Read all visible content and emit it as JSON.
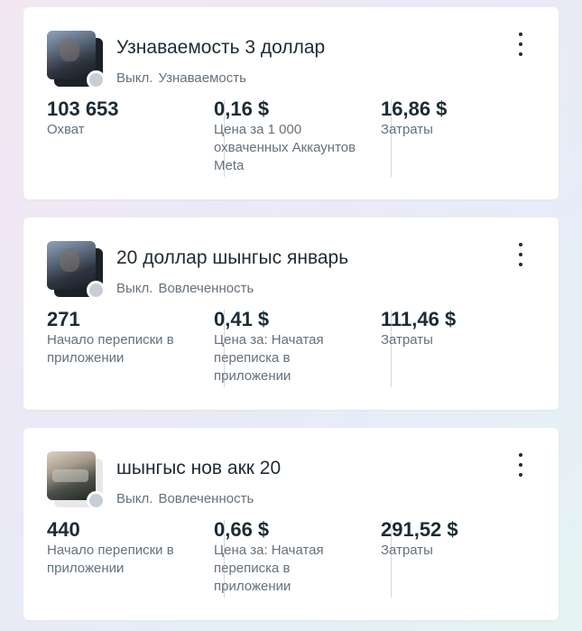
{
  "campaigns": [
    {
      "title": "Узнаваемость 3 доллар",
      "status": "Выкл.",
      "objective": "Узнаваемость",
      "metrics": [
        {
          "value": "103 653",
          "label": "Охват"
        },
        {
          "value": "0,16 $",
          "label": "Цена за 1 000 охваченных Аккаунтов Meta"
        },
        {
          "value": "16,86 $",
          "label": "Затраты"
        }
      ]
    },
    {
      "title": "20 доллар шынгыс январь",
      "status": "Выкл.",
      "objective": "Вовлеченность",
      "metrics": [
        {
          "value": "271",
          "label": "Начало переписки в приложении"
        },
        {
          "value": "0,41 $",
          "label": "Цена за: Начатая переписка в приложении"
        },
        {
          "value": "111,46 $",
          "label": "Затраты"
        }
      ]
    },
    {
      "title": "шынгыс нов акк 20",
      "status": "Выкл.",
      "objective": "Вовлеченность",
      "metrics": [
        {
          "value": "440",
          "label": "Начало переписки в приложении"
        },
        {
          "value": "0,66 $",
          "label": "Цена за: Начатая переписка в приложении"
        },
        {
          "value": "291,52 $",
          "label": "Затраты"
        }
      ]
    }
  ],
  "icons": {
    "menu": "more-vertical-icon",
    "status": "status-off-dot-icon"
  },
  "colors": {
    "text_primary": "#1c2b33",
    "text_secondary": "#65717b",
    "status_off": "#c8ced6"
  }
}
